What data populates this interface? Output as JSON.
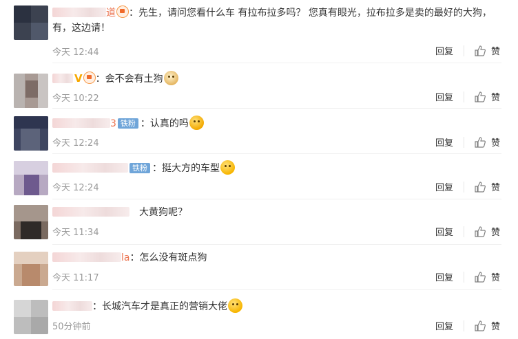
{
  "comments": [
    {
      "name_tail": "道",
      "text": "：先生，请问您看什么车 有拉布拉多吗？ 您真有眼光，拉布拉多是卖的最好的大狗，有，这边请！",
      "time": "今天 12:44",
      "reply": "回复",
      "like": "赞",
      "emoji": ""
    },
    {
      "name_tail": "",
      "text": "：会不会有土狗",
      "time": "今天 10:22",
      "reply": "回复",
      "like": "赞",
      "emoji": "dog-face-emoji"
    },
    {
      "name_tail": "3",
      "badge": "铁粉",
      "text": "：认真的吗",
      "time": "今天 12:24",
      "reply": "回复",
      "like": "赞",
      "emoji": "laughing-crying-emoji"
    },
    {
      "name_tail": "",
      "badge": "铁粉",
      "text": "：挺大方的车型",
      "time": "今天 12:24",
      "reply": "回复",
      "like": "赞",
      "emoji": "thinking-emoji"
    },
    {
      "name_tail": "",
      "text": "大黄狗呢？",
      "time": "今天 11:34",
      "reply": "回复",
      "like": "赞",
      "emoji": ""
    },
    {
      "name_tail": "la",
      "text": "：怎么没有斑点狗",
      "time": "今天 11:17",
      "reply": "回复",
      "like": "赞",
      "emoji": ""
    },
    {
      "name_tail": "",
      "text": "：长城汽车才是真正的营销大佬",
      "time": "50分钟前",
      "reply": "回复",
      "like": "赞",
      "emoji": "grin-emoji"
    }
  ],
  "colors": {
    "username_tail": "#eb7350",
    "badge_bg": "#6fa5d9",
    "meta_text": "#999999"
  }
}
